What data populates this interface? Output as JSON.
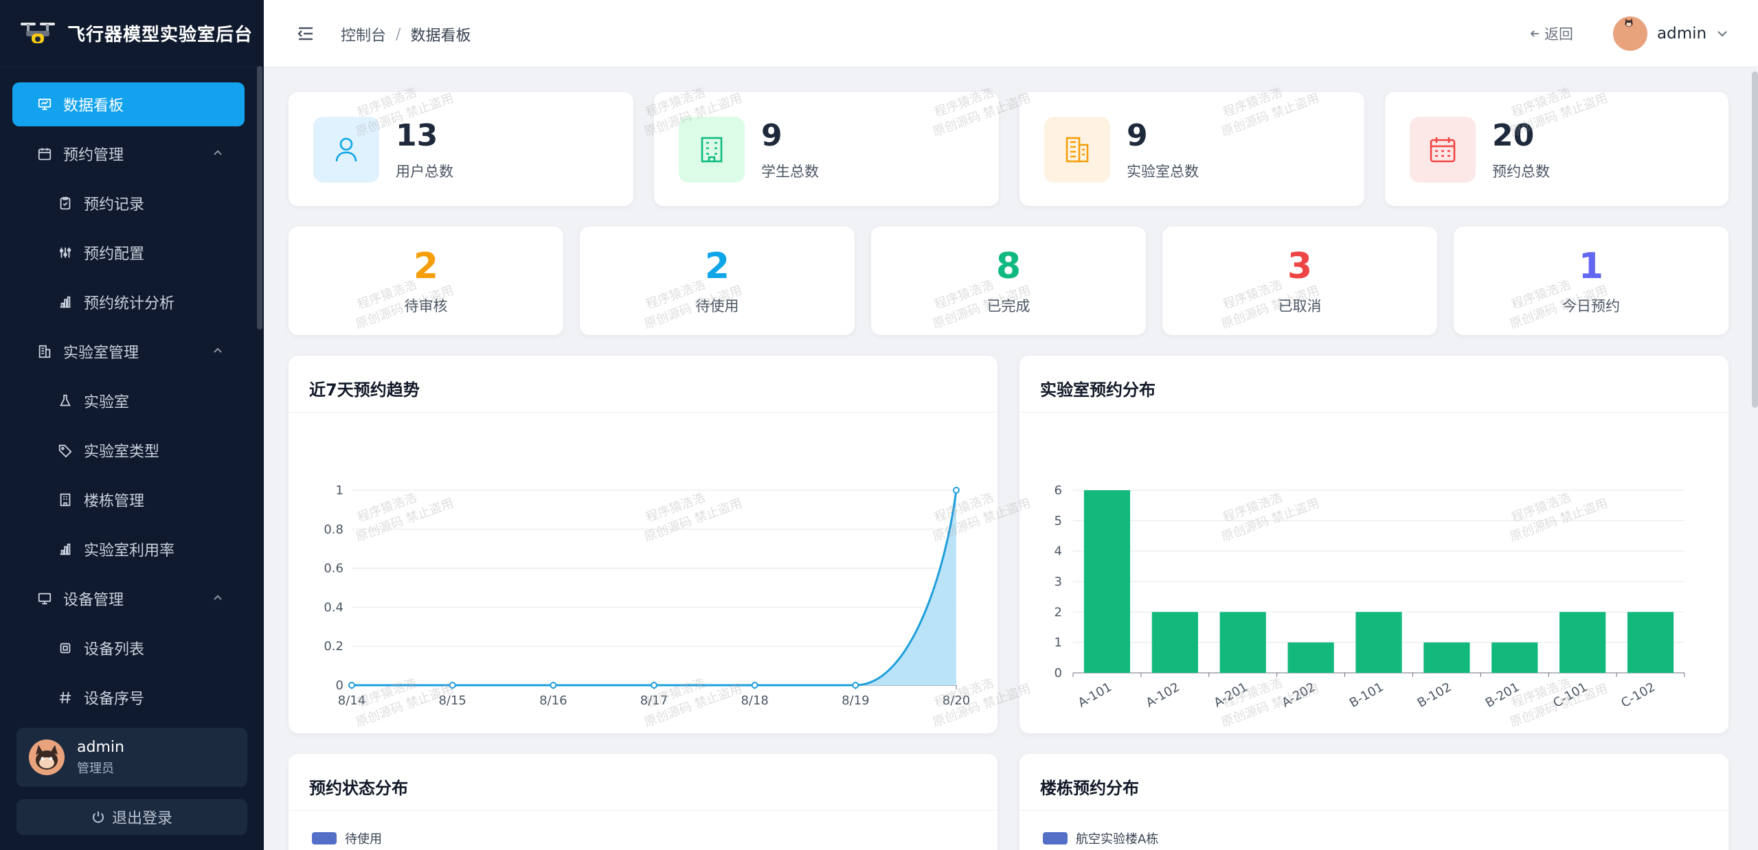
{
  "app": {
    "title": "飞行器模型实验室后台"
  },
  "sidebar": {
    "items": [
      {
        "label": "数据看板",
        "icon": "dashboard-icon",
        "level": "top",
        "active": true
      },
      {
        "label": "预约管理",
        "icon": "calendar-icon",
        "level": "top",
        "expanded": true
      },
      {
        "label": "预约记录",
        "icon": "clipboard-icon",
        "level": "sub"
      },
      {
        "label": "预约配置",
        "icon": "sliders-icon",
        "level": "sub"
      },
      {
        "label": "预约统计分析",
        "icon": "bar-chart-icon",
        "level": "sub"
      },
      {
        "label": "实验室管理",
        "icon": "building-icon",
        "level": "top",
        "expanded": true
      },
      {
        "label": "实验室",
        "icon": "flask-icon",
        "level": "sub"
      },
      {
        "label": "实验室类型",
        "icon": "tag-icon",
        "level": "sub"
      },
      {
        "label": "楼栋管理",
        "icon": "office-icon",
        "level": "sub"
      },
      {
        "label": "实验室利用率",
        "icon": "bar-chart-icon",
        "level": "sub"
      },
      {
        "label": "设备管理",
        "icon": "monitor-icon",
        "level": "top",
        "expanded": true
      },
      {
        "label": "设备列表",
        "icon": "chip-icon",
        "level": "sub"
      },
      {
        "label": "设备序号",
        "icon": "hash-icon",
        "level": "sub"
      }
    ],
    "user": {
      "name": "admin",
      "role": "管理员"
    },
    "logout_label": "退出登录"
  },
  "header": {
    "breadcrumb": [
      "控制台",
      "数据看板"
    ],
    "back_label": "返回",
    "user_name": "admin"
  },
  "stats": [
    {
      "value": "13",
      "label": "用户总数",
      "icon": "user-icon",
      "color": "#0ea5e9",
      "bg": "#e0f2fe"
    },
    {
      "value": "9",
      "label": "学生总数",
      "icon": "building-icon",
      "color": "#10b981",
      "bg": "#dcfce7"
    },
    {
      "value": "9",
      "label": "实验室总数",
      "icon": "office-icon",
      "color": "#f59e0b",
      "bg": "#fef3e2"
    },
    {
      "value": "20",
      "label": "预约总数",
      "icon": "calendar-icon",
      "color": "#ef4444",
      "bg": "#fde8e8"
    }
  ],
  "status": [
    {
      "value": "2",
      "label": "待审核",
      "color": "#f59e0b"
    },
    {
      "value": "2",
      "label": "待使用",
      "color": "#0ea5e9"
    },
    {
      "value": "8",
      "label": "已完成",
      "color": "#10b981"
    },
    {
      "value": "3",
      "label": "已取消",
      "color": "#ef4444"
    },
    {
      "value": "1",
      "label": "今日预约",
      "color": "#6366f1"
    }
  ],
  "panels": {
    "trend_title": "近7天预约趋势",
    "lab_title": "实验室预约分布",
    "status_title": "预约状态分布",
    "building_title": "楼栋预约分布",
    "status_legend": "待使用",
    "building_legend": "航空实验楼A栋",
    "legend_color": "#5470c6"
  },
  "watermark": {
    "line1": "程序猿浩浩",
    "line2": "原创源码 禁止盗用"
  },
  "chart_data": [
    {
      "type": "area",
      "title": "近7天预约趋势",
      "categories": [
        "8/14",
        "8/15",
        "8/16",
        "8/17",
        "8/18",
        "8/19",
        "8/20"
      ],
      "values": [
        0,
        0,
        0,
        0,
        0,
        0,
        1
      ],
      "ylim": [
        0,
        1
      ],
      "yticks": [
        "0",
        "0.2",
        "0.4",
        "0.6",
        "0.8",
        "1"
      ],
      "color": "#1e9fdc",
      "fill": "#b7e2f7",
      "grid": true
    },
    {
      "type": "bar",
      "title": "实验室预约分布",
      "categories": [
        "A-101",
        "A-102",
        "A-201",
        "A-202",
        "B-101",
        "B-102",
        "B-201",
        "C-101",
        "C-102"
      ],
      "values": [
        6,
        2,
        2,
        1,
        2,
        1,
        1,
        2,
        2
      ],
      "ylim": [
        0,
        6
      ],
      "yticks": [
        "0",
        "1",
        "2",
        "3",
        "4",
        "5",
        "6"
      ],
      "color": "#13b97c",
      "grid": true
    }
  ]
}
